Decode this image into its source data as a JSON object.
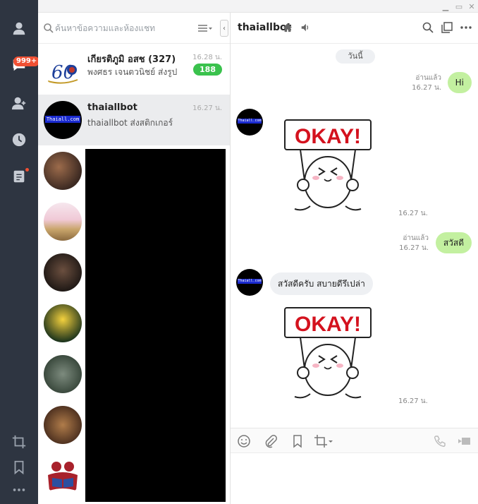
{
  "rail": {
    "badge": "999+"
  },
  "search": {
    "placeholder": "ค้นหาข้อความและห้องแชท"
  },
  "chats": [
    {
      "name": "เกียรติภูมิ อสช (327)",
      "time": "16.28 น.",
      "subtitle": "พงศธร เจนตวนิชย์ ส่งรูป",
      "count": "188",
      "logo_text": "60"
    },
    {
      "name": "thaiallbot",
      "time": "16.27 น.",
      "subtitle": "thaiallbot ส่งสติกเกอร์",
      "avatar_label": "Thaiall.com"
    }
  ],
  "chat": {
    "title": "thaiallbot",
    "date_label": "วันนี้",
    "messages": [
      {
        "type": "out",
        "text": "Hi",
        "read": "อ่านแล้ว",
        "time": "16.27 น."
      },
      {
        "type": "sticker-in",
        "sticker_text": "OKAY!",
        "time": "16.27 น."
      },
      {
        "type": "out",
        "text": "สวัสดี",
        "read": "อ่านแล้ว",
        "time": "16.27 น."
      },
      {
        "type": "in",
        "text": "สวัสดีครับ สบายดีรึเปล่า"
      },
      {
        "type": "sticker-in",
        "sticker_text": "OKAY!",
        "time": "16.27 น."
      }
    ]
  },
  "colors": {
    "rail_bg": "#2e3541",
    "outgoing_bubble": "#c3f0a0",
    "incoming_bubble": "#eef0f3",
    "badge_red": "#f05033",
    "count_green": "#3ac24d",
    "sticker_red": "#d4121e"
  }
}
